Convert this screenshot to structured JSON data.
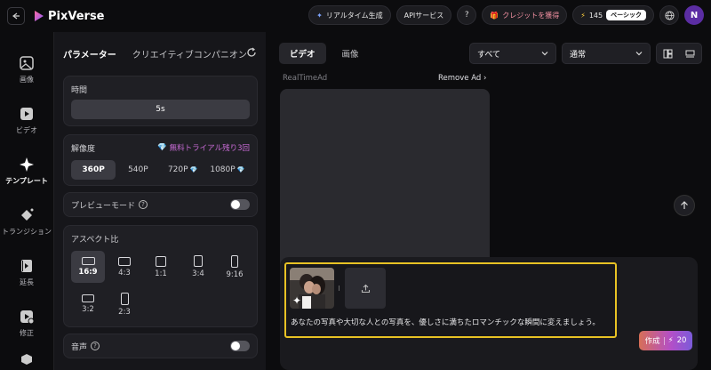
{
  "header": {
    "app_name": "PixVerse",
    "realtime_label": "リアルタイム生成",
    "api_label": "APIサービス",
    "help_icon": "question-icon",
    "credits_label": "クレジットを獲得",
    "credit_count": "145",
    "plan_badge": "ベーシック",
    "avatar_initial": "N",
    "accent_color": "#e8c224"
  },
  "nav": {
    "items": [
      {
        "label": "画像",
        "icon": "image-icon"
      },
      {
        "label": "ビデオ",
        "icon": "video-icon"
      },
      {
        "label": "テンプレート",
        "icon": "sparkle-icon"
      },
      {
        "label": "トランジション",
        "icon": "transition-icon"
      },
      {
        "label": "延長",
        "icon": "extend-icon"
      },
      {
        "label": "修正",
        "icon": "fix-icon"
      }
    ]
  },
  "params": {
    "title": "パラメーター",
    "tab2": "クリエイティブコンパニオン",
    "time_label": "時間",
    "time_value": "5s",
    "resolution_label": "解像度",
    "trial_text": "無料トライアル残り3回",
    "resolutions": [
      "360P",
      "540P",
      "720P",
      "1080P"
    ],
    "preview_label": "プレビューモード",
    "aspect_label": "アスペクト比",
    "aspects": [
      "16:9",
      "4:3",
      "1:1",
      "3:4",
      "9:16",
      "3:2",
      "2:3"
    ],
    "sound_label": "音声"
  },
  "main": {
    "tab_video": "ビデオ",
    "tab_image": "画像",
    "filter_all": "すべて",
    "filter_mode": "通常",
    "ad_label": "RealTimeAd",
    "remove_ad": "Remove Ad",
    "prompt_text": "あなたの写真や大切な人との写真を、優しさに満ちたロマンチックな瞬間に変えましょう。",
    "create_label": "作成",
    "create_cost": "20"
  }
}
